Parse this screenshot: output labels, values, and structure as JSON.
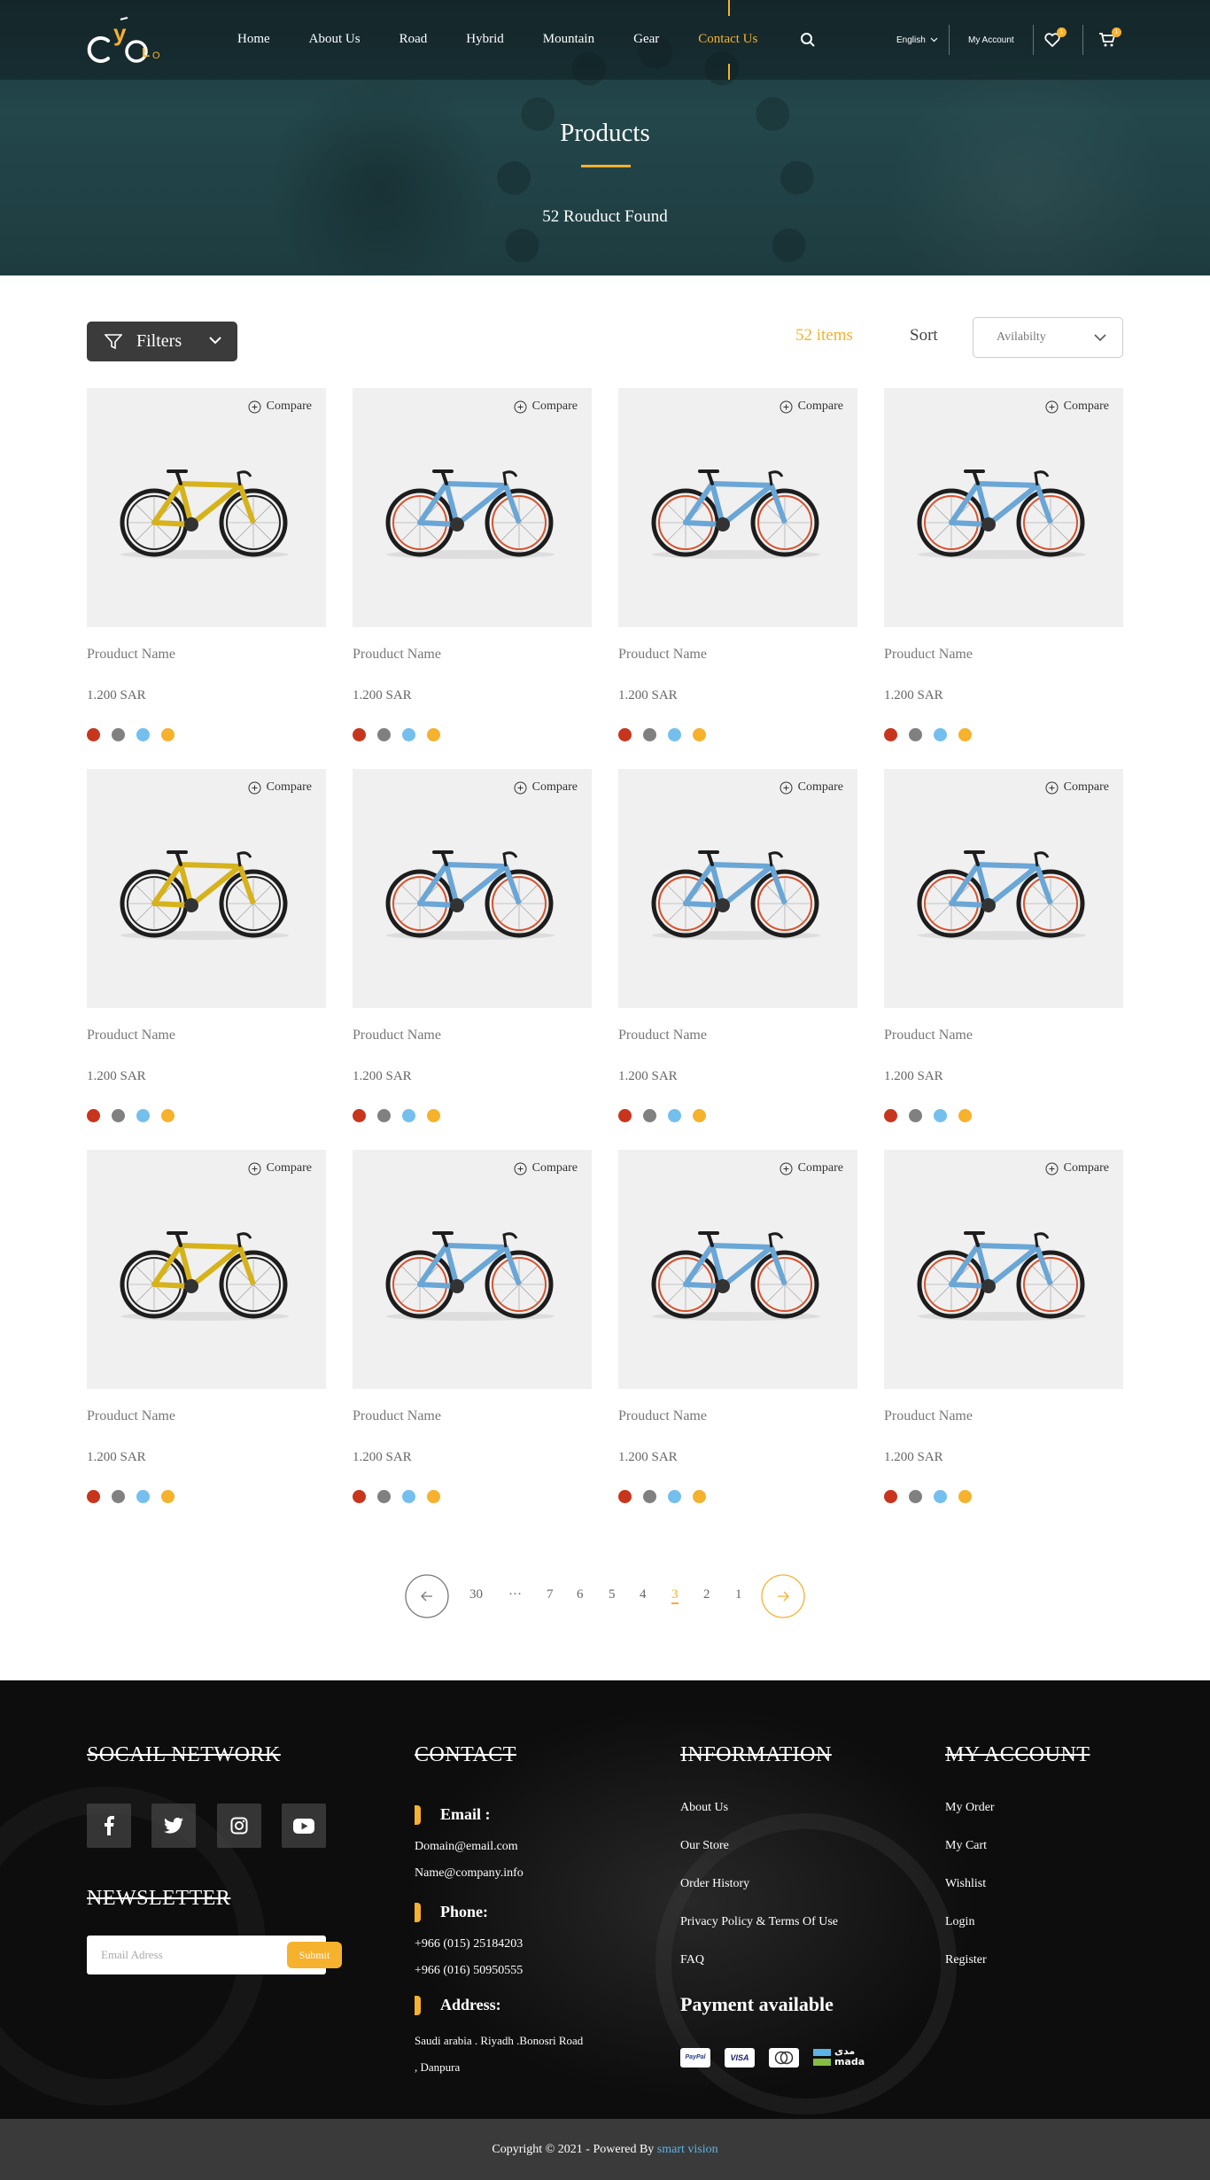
{
  "nav": {
    "items": [
      "Home",
      "About Us",
      "Road",
      "Hybrid",
      "Mountain",
      "Gear",
      "Contact Us"
    ],
    "active": "Contact Us",
    "language": "English",
    "account": "My Account",
    "wishlist_count": "1",
    "cart_count": "1"
  },
  "hero": {
    "title": "Products",
    "subtitle": "52 Rouduct Found"
  },
  "toolbar": {
    "filters_label": "Filters",
    "items_count": "52 items",
    "sort_label": "Sort",
    "sort_value": "Avilabilty"
  },
  "products": {
    "compare_label": "Compare",
    "name": "Prouduct Name",
    "price": "1.200 SAR",
    "colors": [
      "#c7361c",
      "#808080",
      "#74bfee",
      "#f6b12d"
    ],
    "grid": [
      [
        "yellow",
        "blue",
        "blue",
        "blue"
      ],
      [
        "yellow",
        "blue",
        "blue",
        "blue"
      ],
      [
        "yellow",
        "blue",
        "blue",
        "blue"
      ]
    ]
  },
  "pagination": {
    "pages": [
      "30",
      "···",
      "7",
      "6",
      "5",
      "4",
      "3",
      "2",
      "1"
    ],
    "current": "3"
  },
  "footer": {
    "social_title": "SOCAIL NETWORK",
    "social_icons": [
      "facebook-icon",
      "twitter-icon",
      "instagram-icon",
      "youtube-icon"
    ],
    "newsletter_title": "NEWSLETTER",
    "newsletter_placeholder": "Email Adress",
    "newsletter_button": "Submit",
    "contact_title": "CONTACT",
    "email_label": "Email :",
    "emails": [
      "Domain@email.com",
      "Name@company.info"
    ],
    "phone_label": "Phone:",
    "phones": [
      "+966 (015) 25184203",
      "+966 (016) 50950555"
    ],
    "address_label": "Address:",
    "address_lines": [
      "Saudi arabia . Riyadh .Bonosri Road",
      ", Danpura"
    ],
    "information_title": "INFORMATION",
    "information_links": [
      "About Us",
      "Our Store",
      "Order History",
      "Privacy Policy & Terms Of Use",
      "FAQ"
    ],
    "payment_title": "Payment available",
    "payment_methods": [
      "PayPal",
      "VISA",
      "MasterCard",
      "مدى mada"
    ],
    "account_title": "MY ACCOUNT",
    "account_links": [
      "My Order",
      "My Cart",
      "Wishlist",
      "Login",
      "Register"
    ]
  },
  "copyright": {
    "text": "Copyright © 2021 -  Powered By ",
    "brand": "smart vision"
  }
}
